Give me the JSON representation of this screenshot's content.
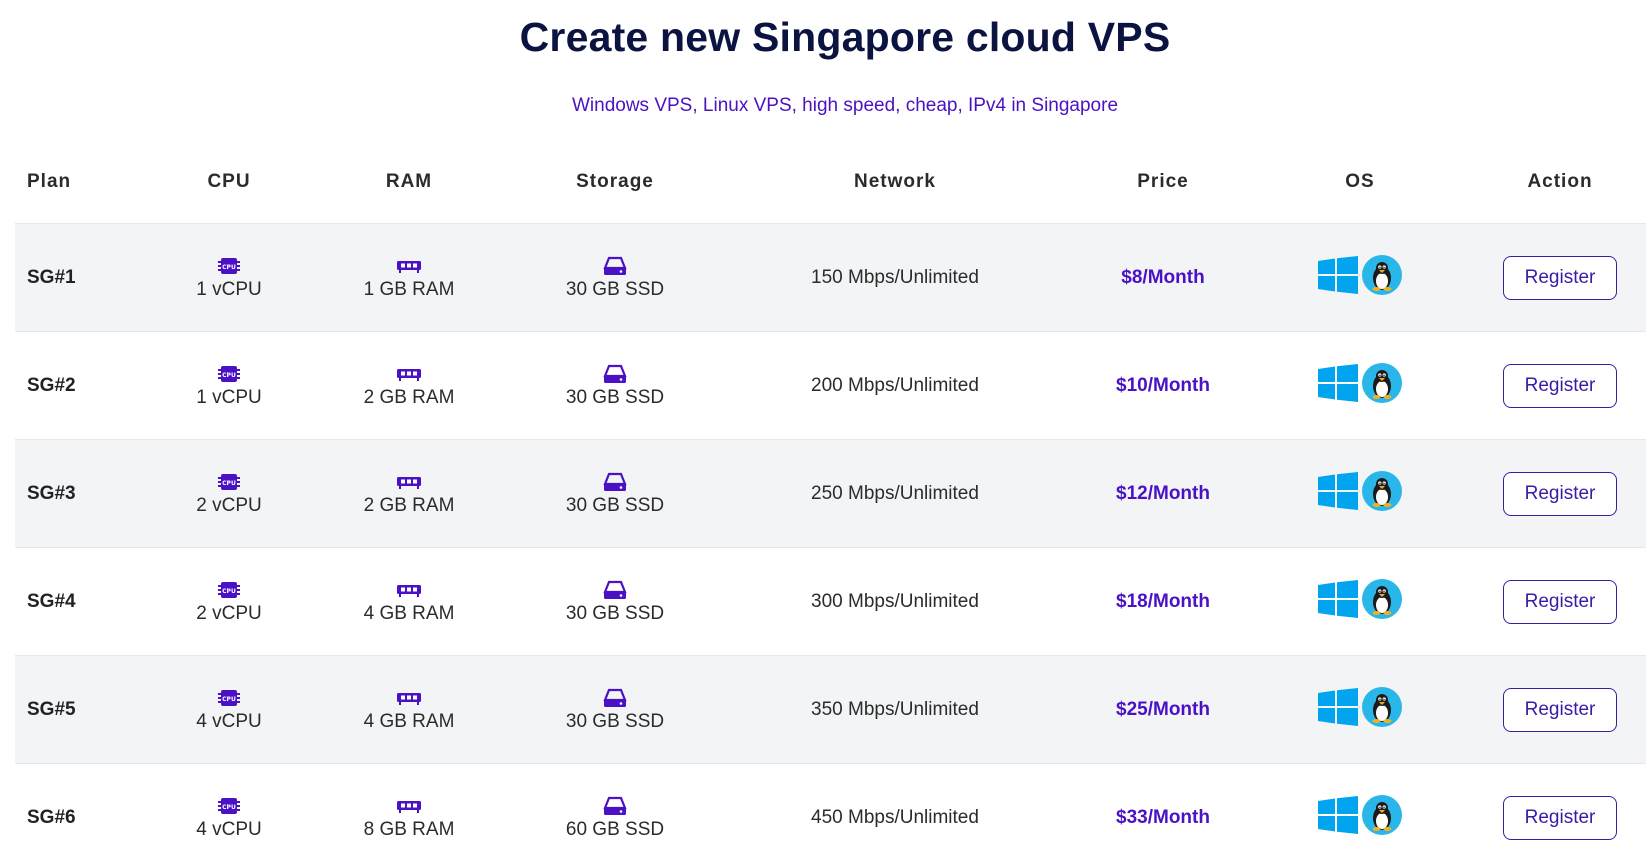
{
  "header": {
    "title": "Create new Singapore cloud VPS",
    "subtitle": "Windows VPS, Linux VPS, high speed, cheap, IPv4 in Singapore"
  },
  "colors": {
    "accent": "#4a12c4",
    "title": "#0b1340",
    "row_alt": "#f3f4f6",
    "windows_blue": "#00a4ef",
    "linux_bg": "#29b6e8"
  },
  "icons": {
    "cpu": "cpu-icon",
    "ram": "ram-icon",
    "storage": "storage-icon",
    "windows": "windows-icon",
    "linux": "linux-icon"
  },
  "table": {
    "columns": [
      "Plan",
      "CPU",
      "RAM",
      "Storage",
      "Network",
      "Price",
      "OS",
      "Action"
    ],
    "cpu_icon_text": "CPU",
    "rows": [
      {
        "plan": "SG#1",
        "cpu": "1 vCPU",
        "ram": "1 GB RAM",
        "storage": "30 GB SSD",
        "network": "150 Mbps/Unlimited",
        "price": "$8/Month",
        "action": "Register"
      },
      {
        "plan": "SG#2",
        "cpu": "1 vCPU",
        "ram": "2 GB RAM",
        "storage": "30 GB SSD",
        "network": "200 Mbps/Unlimited",
        "price": "$10/Month",
        "action": "Register"
      },
      {
        "plan": "SG#3",
        "cpu": "2 vCPU",
        "ram": "2 GB RAM",
        "storage": "30 GB SSD",
        "network": "250 Mbps/Unlimited",
        "price": "$12/Month",
        "action": "Register"
      },
      {
        "plan": "SG#4",
        "cpu": "2 vCPU",
        "ram": "4 GB RAM",
        "storage": "30 GB SSD",
        "network": "300 Mbps/Unlimited",
        "price": "$18/Month",
        "action": "Register"
      },
      {
        "plan": "SG#5",
        "cpu": "4 vCPU",
        "ram": "4 GB RAM",
        "storage": "30 GB SSD",
        "network": "350 Mbps/Unlimited",
        "price": "$25/Month",
        "action": "Register"
      },
      {
        "plan": "SG#6",
        "cpu": "4 vCPU",
        "ram": "8 GB RAM",
        "storage": "60 GB SSD",
        "network": "450 Mbps/Unlimited",
        "price": "$33/Month",
        "action": "Register"
      }
    ]
  }
}
